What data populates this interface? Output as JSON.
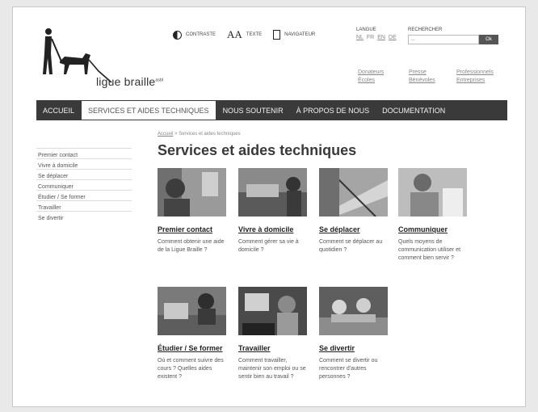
{
  "brand": {
    "name": "ligue braille",
    "mark": "asbl"
  },
  "toolbar": {
    "contrast_label": "Contraste",
    "text_label": "Texte",
    "text_icon": "AA",
    "navigator_label": "Navigateur"
  },
  "language": {
    "label": "Langue",
    "options": [
      "NL",
      "FR",
      "EN",
      "DE"
    ]
  },
  "search": {
    "label": "Rechercher",
    "placeholder": "...",
    "button_label": "Ok"
  },
  "quicklinks": {
    "col1": [
      "Donateurs",
      "Écoles"
    ],
    "col2": [
      "Presse",
      "Bénévoles"
    ],
    "col3": [
      "Professionnels",
      "Entreprises"
    ]
  },
  "nav": {
    "items": [
      "Accueil",
      "Services et aides techniques",
      "Nous soutenir",
      "À propos de nous",
      "Documentation"
    ],
    "active_index": 1
  },
  "sidebar": {
    "items": [
      "Premier contact",
      "Vivre à domicile",
      "Se déplacer",
      "Communiquer",
      "Étudier / Se former",
      "Travailler",
      "Se divertir"
    ]
  },
  "breadcrumb": {
    "home": "Accueil",
    "separator": ">",
    "current": "Services et aides techniques"
  },
  "page": {
    "title": "Services et aides techniques"
  },
  "cards": [
    {
      "title": "Premier contact",
      "desc": "Comment obtenir une aide de la Ligue Braille ?"
    },
    {
      "title": "Vivre à domicile",
      "desc": "Comment gérer sa vie à domicile ?"
    },
    {
      "title": "Se déplacer",
      "desc": "Comment se déplacer au quotidien ?"
    },
    {
      "title": "Communiquer",
      "desc": "Quels moyens de communication utiliser et comment bien servir ?"
    },
    {
      "title": "Étudier / Se former",
      "desc": "Où et comment suivre des cours ? Quelles aides existent ?"
    },
    {
      "title": "Travailler",
      "desc": "Comment travailler, maintenir son emploi ou se sentir bien au travail ?"
    },
    {
      "title": "Se divertir",
      "desc": "Comment se divertir ou rencontrer d'autres personnes ?"
    }
  ],
  "colors": {
    "nav_bg": "#3a3a3a",
    "nav_active_bg": "#ffffff",
    "title": "#3a3a3a"
  }
}
